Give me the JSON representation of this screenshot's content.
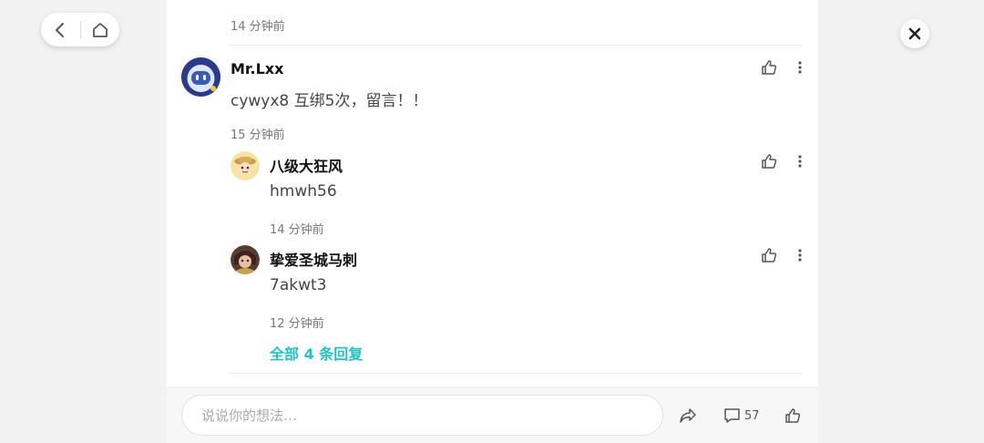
{
  "nav": {
    "back_icon": "chevron-left-icon",
    "home_icon": "home-icon"
  },
  "close_icon": "close-icon",
  "thread": {
    "top_time": "14 分钟前",
    "main_comment": {
      "username": "Mr.Lxx",
      "text": "cywyx8 互绑5次，留言！！",
      "time": "15 分钟前"
    },
    "replies": [
      {
        "username": "八级大狂风",
        "text": "hmwh56",
        "time": "14 分钟前"
      },
      {
        "username": "挚爱圣城马刺",
        "text": "7akwt3",
        "time": "12 分钟前"
      }
    ],
    "all_replies_label": "全部 4 条回复"
  },
  "bottom_bar": {
    "input_placeholder": "说说你的想法…",
    "comment_count": "57"
  },
  "colors": {
    "accent": "#1ec3c7",
    "background": "#f2f2f2",
    "panel": "#ffffff"
  }
}
